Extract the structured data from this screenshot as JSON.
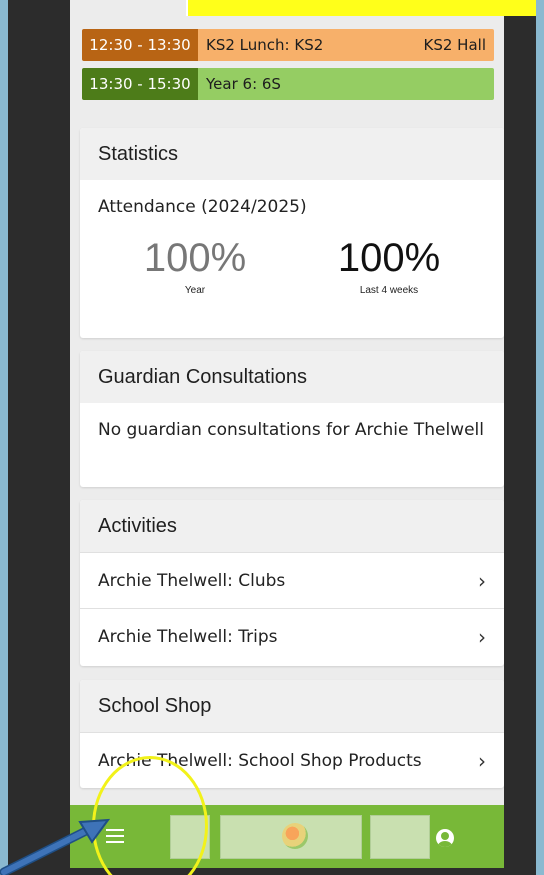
{
  "timetable": [
    {
      "time": "12:30 - 13:30",
      "title": "KS2 Lunch: KS2",
      "location": "KS2 Hall"
    },
    {
      "time": "13:30 - 15:30",
      "title": "Year 6: 6S",
      "location": ""
    }
  ],
  "statistics": {
    "header": "Statistics",
    "attendance_label": "Attendance (2024/2025)",
    "year_value": "100%",
    "year_caption": "Year",
    "recent_value": "100%",
    "recent_caption": "Last 4 weeks"
  },
  "consultations": {
    "header": "Guardian Consultations",
    "message": "No guardian consultations for Archie Thelwell"
  },
  "activities": {
    "header": "Activities",
    "items": [
      {
        "label": "Archie Thelwell: Clubs"
      },
      {
        "label": "Archie Thelwell: Trips"
      }
    ]
  },
  "shop": {
    "header": "School Shop",
    "items": [
      {
        "label": "Archie Thelwell: School Shop Products"
      }
    ]
  },
  "colors": {
    "bottom_bar": "#78b838",
    "lunch_time": "#b86414",
    "lunch_body": "#f7b06a",
    "lesson_time": "#4d7c19",
    "lesson_body": "#95cd63",
    "annotation": "#f2f21a"
  },
  "icons": {
    "chevron": "chevron-right-icon",
    "menu": "hamburger-menu-icon",
    "profile": "profile-icon"
  }
}
